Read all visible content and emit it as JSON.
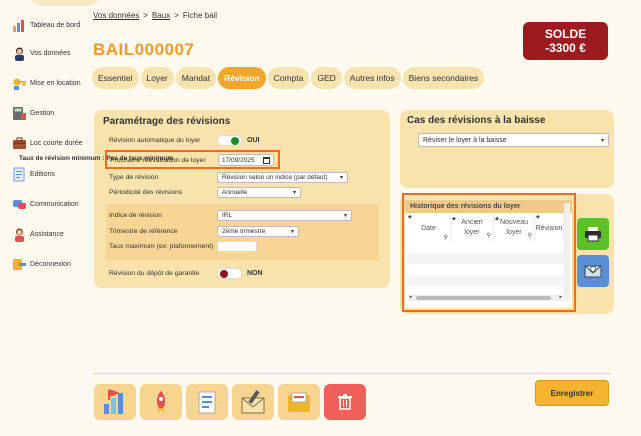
{
  "sidebar": {
    "items": [
      {
        "label": "Tableau de bord",
        "icon": "chart-icon"
      },
      {
        "label": "Vos données",
        "icon": "user-icon"
      },
      {
        "label": "Mise en location",
        "icon": "key-icon"
      },
      {
        "label": "Gestion",
        "icon": "calculator-icon"
      },
      {
        "label": "Loc courte durée",
        "icon": "suitcase-icon"
      },
      {
        "label": "Editions",
        "icon": "document-icon"
      },
      {
        "label": "Communication",
        "icon": "megaphone-icon"
      },
      {
        "label": "Assistance",
        "icon": "support-icon"
      },
      {
        "label": "Déconnexion",
        "icon": "power-icon"
      }
    ]
  },
  "breadcrumb": {
    "items": [
      "Vos données",
      "Baux",
      "Fiche bail"
    ],
    "separator": ">"
  },
  "page_title": "BAIL000007",
  "solde": {
    "label": "SOLDE",
    "value": "-3300 €"
  },
  "tabs": [
    "Essentiel",
    "Loyer",
    "Mandat",
    "Révision",
    "Compta",
    "GED",
    "Autres infos",
    "Biens secondaires"
  ],
  "active_tab": "Révision",
  "revision": {
    "title": "Paramétrage des révisions",
    "auto_label": "Révision automatique du loyer",
    "auto_value": "OUI",
    "next_label": "Prochaine réévaluation de loyer",
    "next_value": "17/09/2025",
    "type_label": "Type de révision",
    "type_value": "Révision selon un indice (par défaut)",
    "period_label": "Périodicité des révisions",
    "period_value": "Annuelle",
    "index_label": "Indice de révision",
    "index_value": "IRL",
    "quarter_label": "Trimestre de référence",
    "quarter_value": "2ème trimestre",
    "max_label": "Taux maximum (ex: plafonnement)",
    "max_value": "",
    "deposit_label": "Révision du dépôt de garantie",
    "deposit_value": "NON"
  },
  "baisse": {
    "title": "Cas des révisions à la baisse",
    "select_value": "Réviser le loyer à la baisse",
    "note": "Taux de révision minimum : Pas de taux minimum"
  },
  "historique": {
    "title": "Historique des révisions du loyer",
    "columns": [
      "Date",
      "Ancien loyer",
      "Nouveau loyer",
      "Révision"
    ]
  },
  "actions": {
    "save_label": "Enregistrer"
  },
  "colors": {
    "accent": "#f4a62a",
    "title": "#f29b25",
    "solde": "#9b1b1f",
    "highlight": "#ef6b1f",
    "print": "#5fbf2a",
    "email": "#5a8fd8",
    "delete": "#f0605a"
  }
}
